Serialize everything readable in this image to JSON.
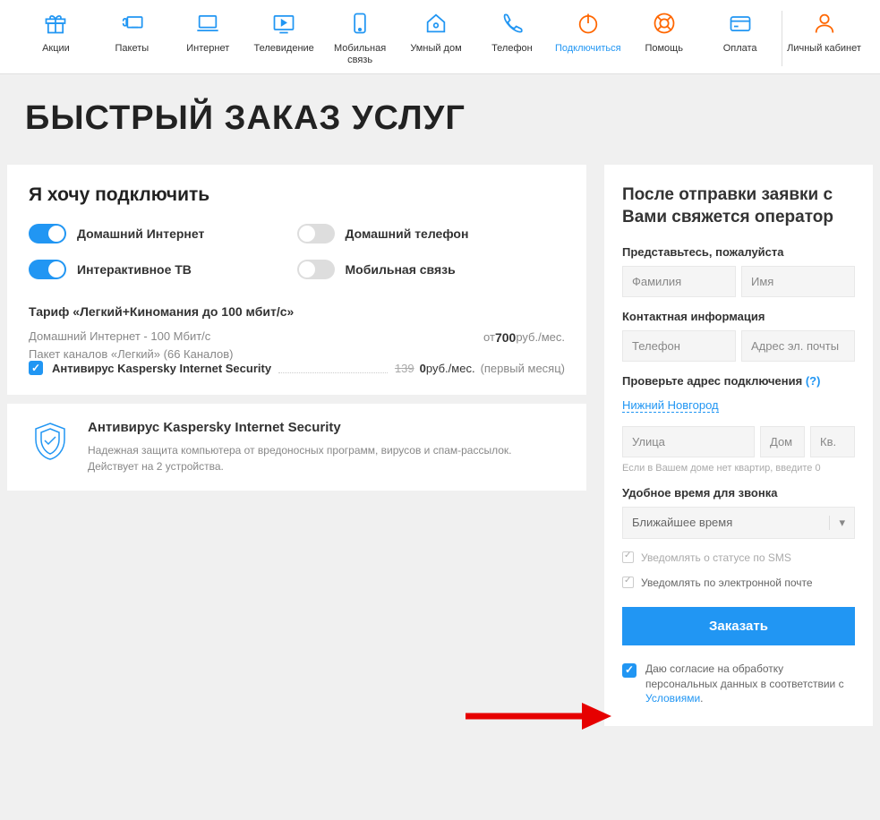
{
  "nav": [
    {
      "label": "Акции",
      "name": "promo"
    },
    {
      "label": "Пакеты",
      "name": "packages"
    },
    {
      "label": "Интернет",
      "name": "internet"
    },
    {
      "label": "Телевидение",
      "name": "tv"
    },
    {
      "label": "Мобильная связь",
      "name": "mobile"
    },
    {
      "label": "Умный дом",
      "name": "smarthome"
    },
    {
      "label": "Телефон",
      "name": "phone"
    },
    {
      "label": "Подключиться",
      "name": "connect",
      "accent": true
    },
    {
      "label": "Помощь",
      "name": "help"
    },
    {
      "label": "Оплата",
      "name": "payment"
    },
    {
      "label": "Личный кабинет",
      "name": "account"
    }
  ],
  "page_title": "БЫСТРЫЙ ЗАКАЗ УСЛУГ",
  "connect": {
    "title": "Я хочу подключить",
    "toggles": [
      {
        "label": "Домашний Интернет",
        "on": true
      },
      {
        "label": "Домашний телефон",
        "on": false
      },
      {
        "label": "Интерактивное ТВ",
        "on": true
      },
      {
        "label": "Мобильная связь",
        "on": false
      }
    ]
  },
  "tariff": {
    "title": "Тариф «Легкий+Киномания до 100 мбит/с»",
    "line1": "Домашний Интернет - 100 Мбит/с",
    "line2": "Пакет каналов «Легкий» (66 Каналов)",
    "price_prefix": "от ",
    "price": "700",
    "price_suffix": " руб./мес."
  },
  "addon": {
    "name": "Антивирус Kaspersky Internet Security",
    "old_price": "139",
    "new_price": "0",
    "suffix": " руб./мес.",
    "note": "(первый месяц)"
  },
  "promo": {
    "title": "Антивирус Kaspersky Internet Security",
    "desc": "Надежная защита компьютера от вредоносных программ, вирусов и спам-рассылок. Действует на 2 устройства."
  },
  "form": {
    "title": "После отправки заявки с Вами свяжется оператор",
    "name_label": "Представьтесь, пожалуйста",
    "lastname_ph": "Фамилия",
    "firstname_ph": "Имя",
    "contact_label": "Контактная информация",
    "phone_ph": "Телефон",
    "email_ph": "Адрес эл. почты",
    "address_label": "Проверьте адрес подключения",
    "address_help": "(?)",
    "city": "Нижний Новгород",
    "street_ph": "Улица",
    "house_ph": "Дом",
    "apt_ph": "Кв.",
    "apt_hint": "Если в Вашем доме нет квартир, введите 0",
    "time_label": "Удобное время для звонка",
    "time_value": "Ближайшее время",
    "notify_sms": "Уведомлять о статусе по SMS",
    "notify_email": "Уведомлять по электронной почте",
    "order_btn": "Заказать",
    "consent_text": "Даю согласие на обработку персональных данных в соответствии с ",
    "consent_link": "Условиями",
    "consent_dot": "."
  }
}
